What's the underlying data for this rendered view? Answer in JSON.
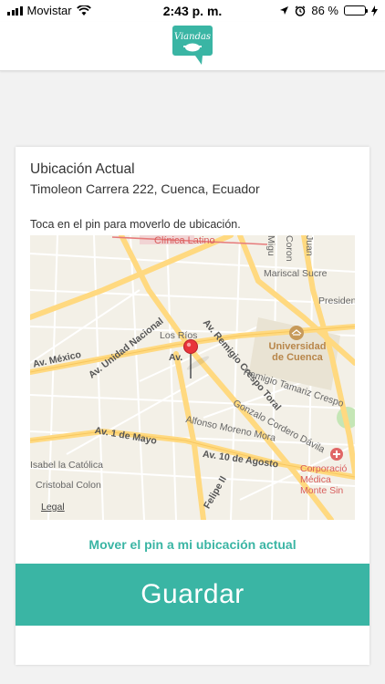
{
  "status_bar": {
    "carrier": "Movistar",
    "time": "2:43 p. m.",
    "battery": "86 %",
    "battery_level": 0.86
  },
  "header": {
    "logo_text": "Viandas"
  },
  "location": {
    "title": "Ubicación Actual",
    "address": "Timoleon Carrera 222, Cuenca, Ecuador",
    "instruction": "Toca en el pin para moverlo de ubicación."
  },
  "map": {
    "labels": {
      "clinica": "Clínica Latino",
      "marical": "Mariscal Sucre",
      "presidente": "President",
      "los_rios": "Los Ríos",
      "unidad_nacional": "Av. Unidad Nacional",
      "remigio_crespo": "Av. Remigio Crespo Toral",
      "universidad": "Universidad de Cuenca",
      "tamariz": "Remigio Tamariz Crespo",
      "mexico": "Av. México",
      "av_short": "Av.",
      "gonzalo": "Gonzalo Cordero Dávila",
      "alfonso": "Alfonso Moreno Mora",
      "primero_mayo": "Av. 1 de Mayo",
      "diez_agosto": "Av. 10 de Agosto",
      "isabel": "Isabel la Católica",
      "corporacion": "Corporació Médica Monte Sin",
      "cristobal": "Cristobal Colon",
      "felipe": "Felipe II",
      "legal": "Legal",
      "miguel": "Migu",
      "coron": "Coron",
      "juan": "Juan"
    },
    "road_color": "#ffd980",
    "park_color": "#c5e6b6"
  },
  "actions": {
    "move_pin": "Mover el pin a mi ubicación actual",
    "save": "Guardar"
  },
  "colors": {
    "accent": "#3ab5a4",
    "pin": "#e8343b"
  }
}
